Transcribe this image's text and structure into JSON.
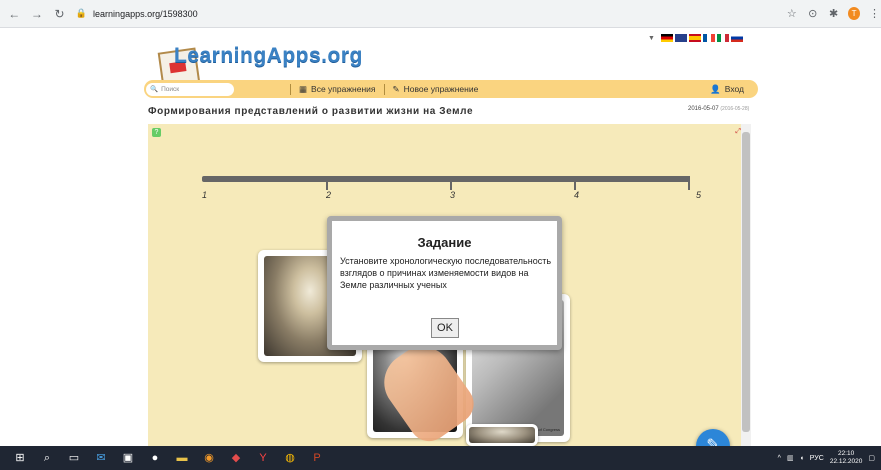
{
  "browser": {
    "url": "learningapps.org/1598300",
    "icons": [
      "back-icon",
      "forward-icon",
      "reload-icon",
      "lock-icon",
      "star-icon",
      "extension-icon",
      "puzzle-icon"
    ],
    "avatar_letter": "T"
  },
  "site": {
    "logo": "LearningApps.org",
    "search_placeholder": "Поиск",
    "menu_all": "Все упражнения",
    "menu_new": "Новое упражнение",
    "login": "Вход"
  },
  "exercise": {
    "title": "Формирования представлений о развитии жизни на Земле",
    "date": "2016-05-07",
    "date_small": "(2016-05-28)",
    "tick_labels": [
      "1",
      "2",
      "3",
      "4",
      "5"
    ]
  },
  "dialog": {
    "title": "Задание",
    "text": "Установите хронологическую последовательность взглядов о причинах изменяемости видов на Земле различных ученых",
    "ok": "OK"
  },
  "card_caption": "Library of Congress",
  "taskbar": {
    "lang": "РУС",
    "time": "22:10",
    "date": "22.12.2020"
  },
  "colors": {
    "menu": "#fad480",
    "frame": "#f6eaba",
    "accent": "#3b82c4",
    "fab": "#2c86d8"
  }
}
